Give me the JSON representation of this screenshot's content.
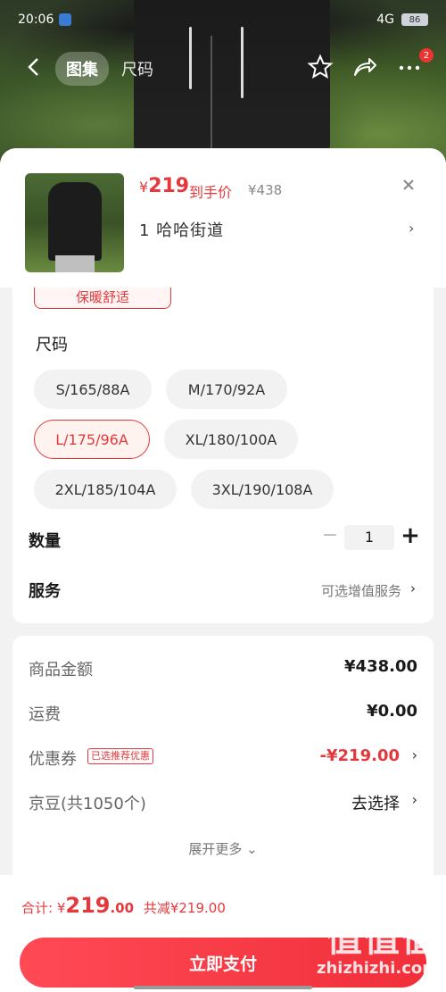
{
  "status_bar": {
    "time": "20:06",
    "network": "4G",
    "battery": "86"
  },
  "nav": {
    "tab_gallery": "图集",
    "tab_size": "尺码",
    "cart_badge": "2"
  },
  "product": {
    "price_symbol": "¥",
    "price": "219",
    "price_tag": "到手价",
    "original_price": "¥438",
    "selected_spec": "1  哈哈街道"
  },
  "options": {
    "prev_chip": "保暖舒适",
    "size_title": "尺码",
    "sizes": [
      "S/165/88A",
      "M/170/92A",
      "L/175/96A",
      "XL/180/100A",
      "2XL/185/104A",
      "3XL/190/108A"
    ],
    "selected_size": "L/175/96A",
    "qty_label": "数量",
    "qty_value": "1",
    "service_label": "服务",
    "service_value": "可选增值服务"
  },
  "fees": {
    "goods_label": "商品金额",
    "goods_value": "¥438.00",
    "shipping_label": "运费",
    "shipping_value": "¥0.00",
    "coupon_label": "优惠券",
    "coupon_tag": "已选推荐优惠",
    "coupon_value": "-¥219.00",
    "jingdou_label": "京豆(共1050个)",
    "jingdou_value": "去选择",
    "expand_more": "展开更多"
  },
  "footer": {
    "total_label": "合计: ¥",
    "total_int": "219",
    "total_dec": ".00",
    "discount": "共减¥219.00",
    "pay_button": "立即支付"
  },
  "watermark": {
    "logo_text": "值值值",
    "site": "zhizhizhi.com"
  },
  "colors": {
    "accent": "#e4393c"
  }
}
